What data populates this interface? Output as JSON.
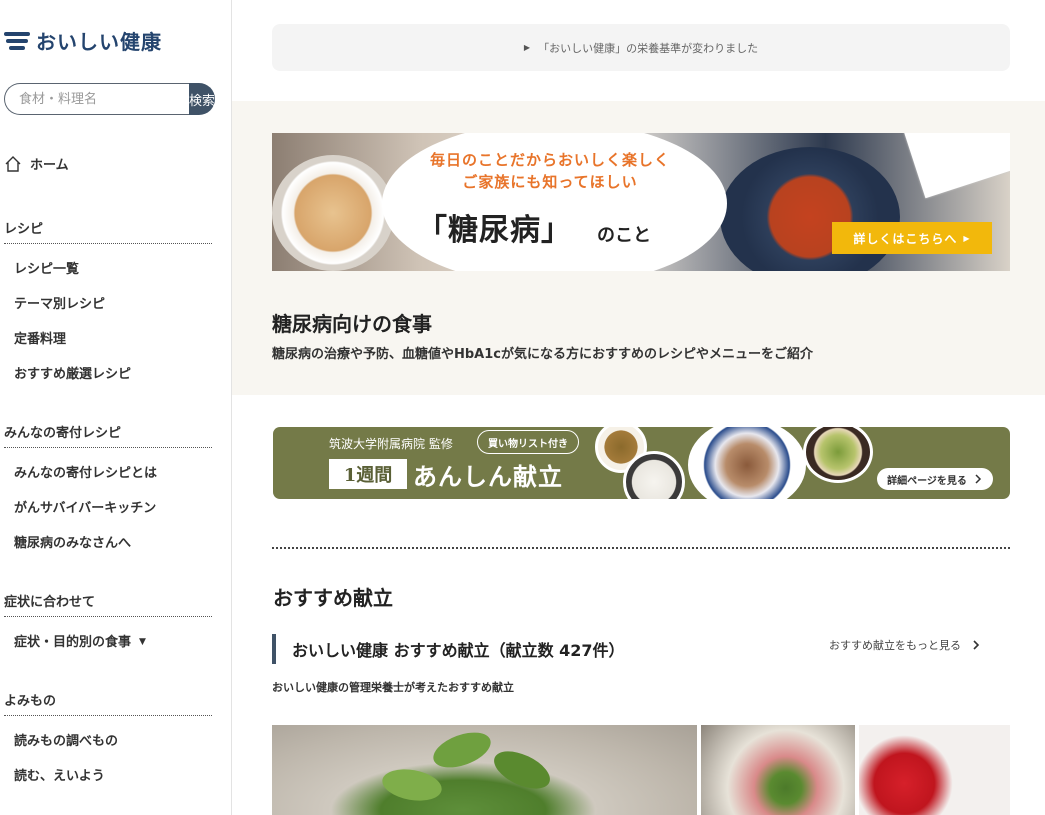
{
  "brand": {
    "name": "おいしい健康",
    "color": "#24446e"
  },
  "search": {
    "placeholder": "食材・料理名",
    "button_label": "検索"
  },
  "sidebar": {
    "home_label": "ホーム",
    "sections": [
      {
        "heading": "レシピ",
        "items": [
          "レシピ一覧",
          "テーマ別レシピ",
          "定番料理",
          "おすすめ厳選レシピ"
        ]
      },
      {
        "heading": "みんなの寄付レシピ",
        "items": [
          "みんなの寄付レシピとは",
          "がんサバイバーキッチン",
          "糖尿病のみなさんへ"
        ]
      },
      {
        "heading": "症状に合わせて",
        "items": [
          "症状・目的別の食事"
        ]
      },
      {
        "heading": "よみもの",
        "items": [
          "読みもの調べもの",
          "読む、えいよう"
        ]
      }
    ]
  },
  "notice": {
    "text": "「おいしい健康」の栄養基準が変わりました"
  },
  "banner_diabetes": {
    "top_line1": "毎日のことだからおいしく楽しく",
    "top_line2": "ご家族にも知ってほしい",
    "main": "「糖尿病」",
    "sub": "のこと",
    "button": "詳しくはこちらへ"
  },
  "section": {
    "title": "糖尿病向けの食事",
    "description": "糖尿病の治療や予防、血糖値やHbA1cが気になる方におすすめのレシピやメニューをご紹介"
  },
  "banner_week": {
    "supervisor": "筑波大学附属病院 監修",
    "bubble": "買い物リスト付き",
    "week": "1週間",
    "title": "あんしん献立",
    "button": "詳細ページを見る"
  },
  "recommended": {
    "title": "おすすめ献立",
    "subtitle": "おいしい健康 おすすめ献立（献立数 427件）",
    "more": "おすすめ献立をもっと見る",
    "description": "おいしい健康の管理栄養士が考えたおすすめ献立"
  },
  "colors": {
    "accent": "#3f5267",
    "orange": "#e8742a",
    "yellow": "#f2b80c",
    "olive": "#747a48",
    "beige": "#f8f6f1"
  }
}
